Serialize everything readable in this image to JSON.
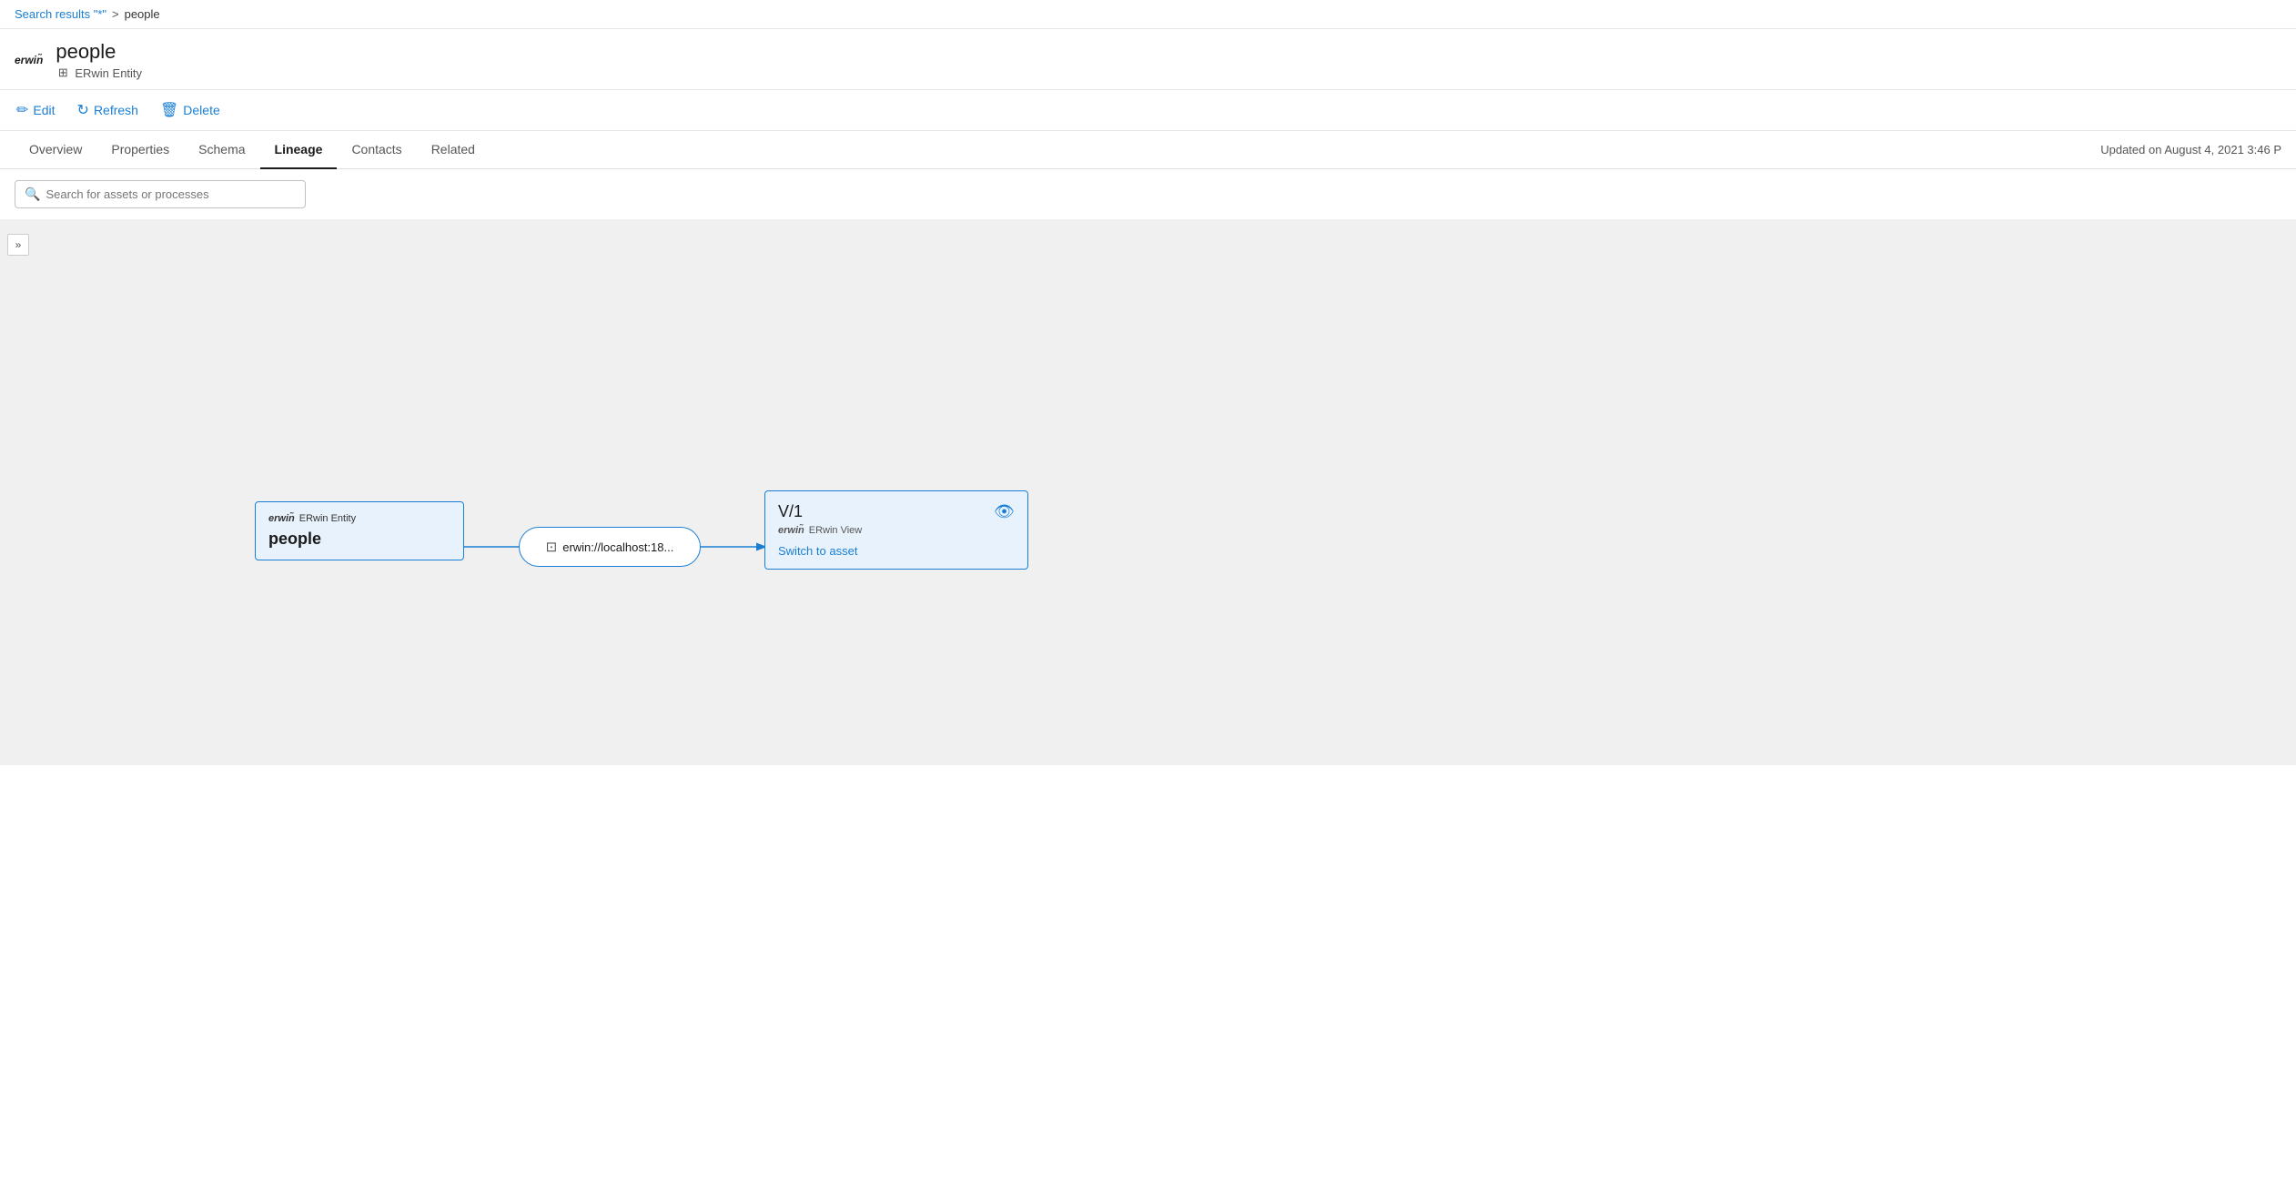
{
  "breadcrumb": {
    "search_link": "Search results \"*\"",
    "separator": ">",
    "current": "people"
  },
  "header": {
    "logo": "erwin",
    "title": "people",
    "subtitle": "ERwin Entity",
    "entity_icon": "⊞"
  },
  "toolbar": {
    "edit_label": "Edit",
    "refresh_label": "Refresh",
    "delete_label": "Delete"
  },
  "tabs": {
    "items": [
      "Overview",
      "Properties",
      "Schema",
      "Lineage",
      "Contacts",
      "Related"
    ],
    "active": "Lineage",
    "updated_text": "Updated on August 4, 2021 3:46 P"
  },
  "search": {
    "placeholder": "Search for assets or processes"
  },
  "lineage": {
    "expand_icon": "»",
    "source_node": {
      "brand": "erwin",
      "type": "ERwin Entity",
      "name": "people"
    },
    "process_node": {
      "label": "erwin://localhost:18..."
    },
    "target_node": {
      "title": "V/1",
      "brand": "erwin",
      "type": "ERwin View",
      "switch_link": "Switch to asset"
    }
  }
}
